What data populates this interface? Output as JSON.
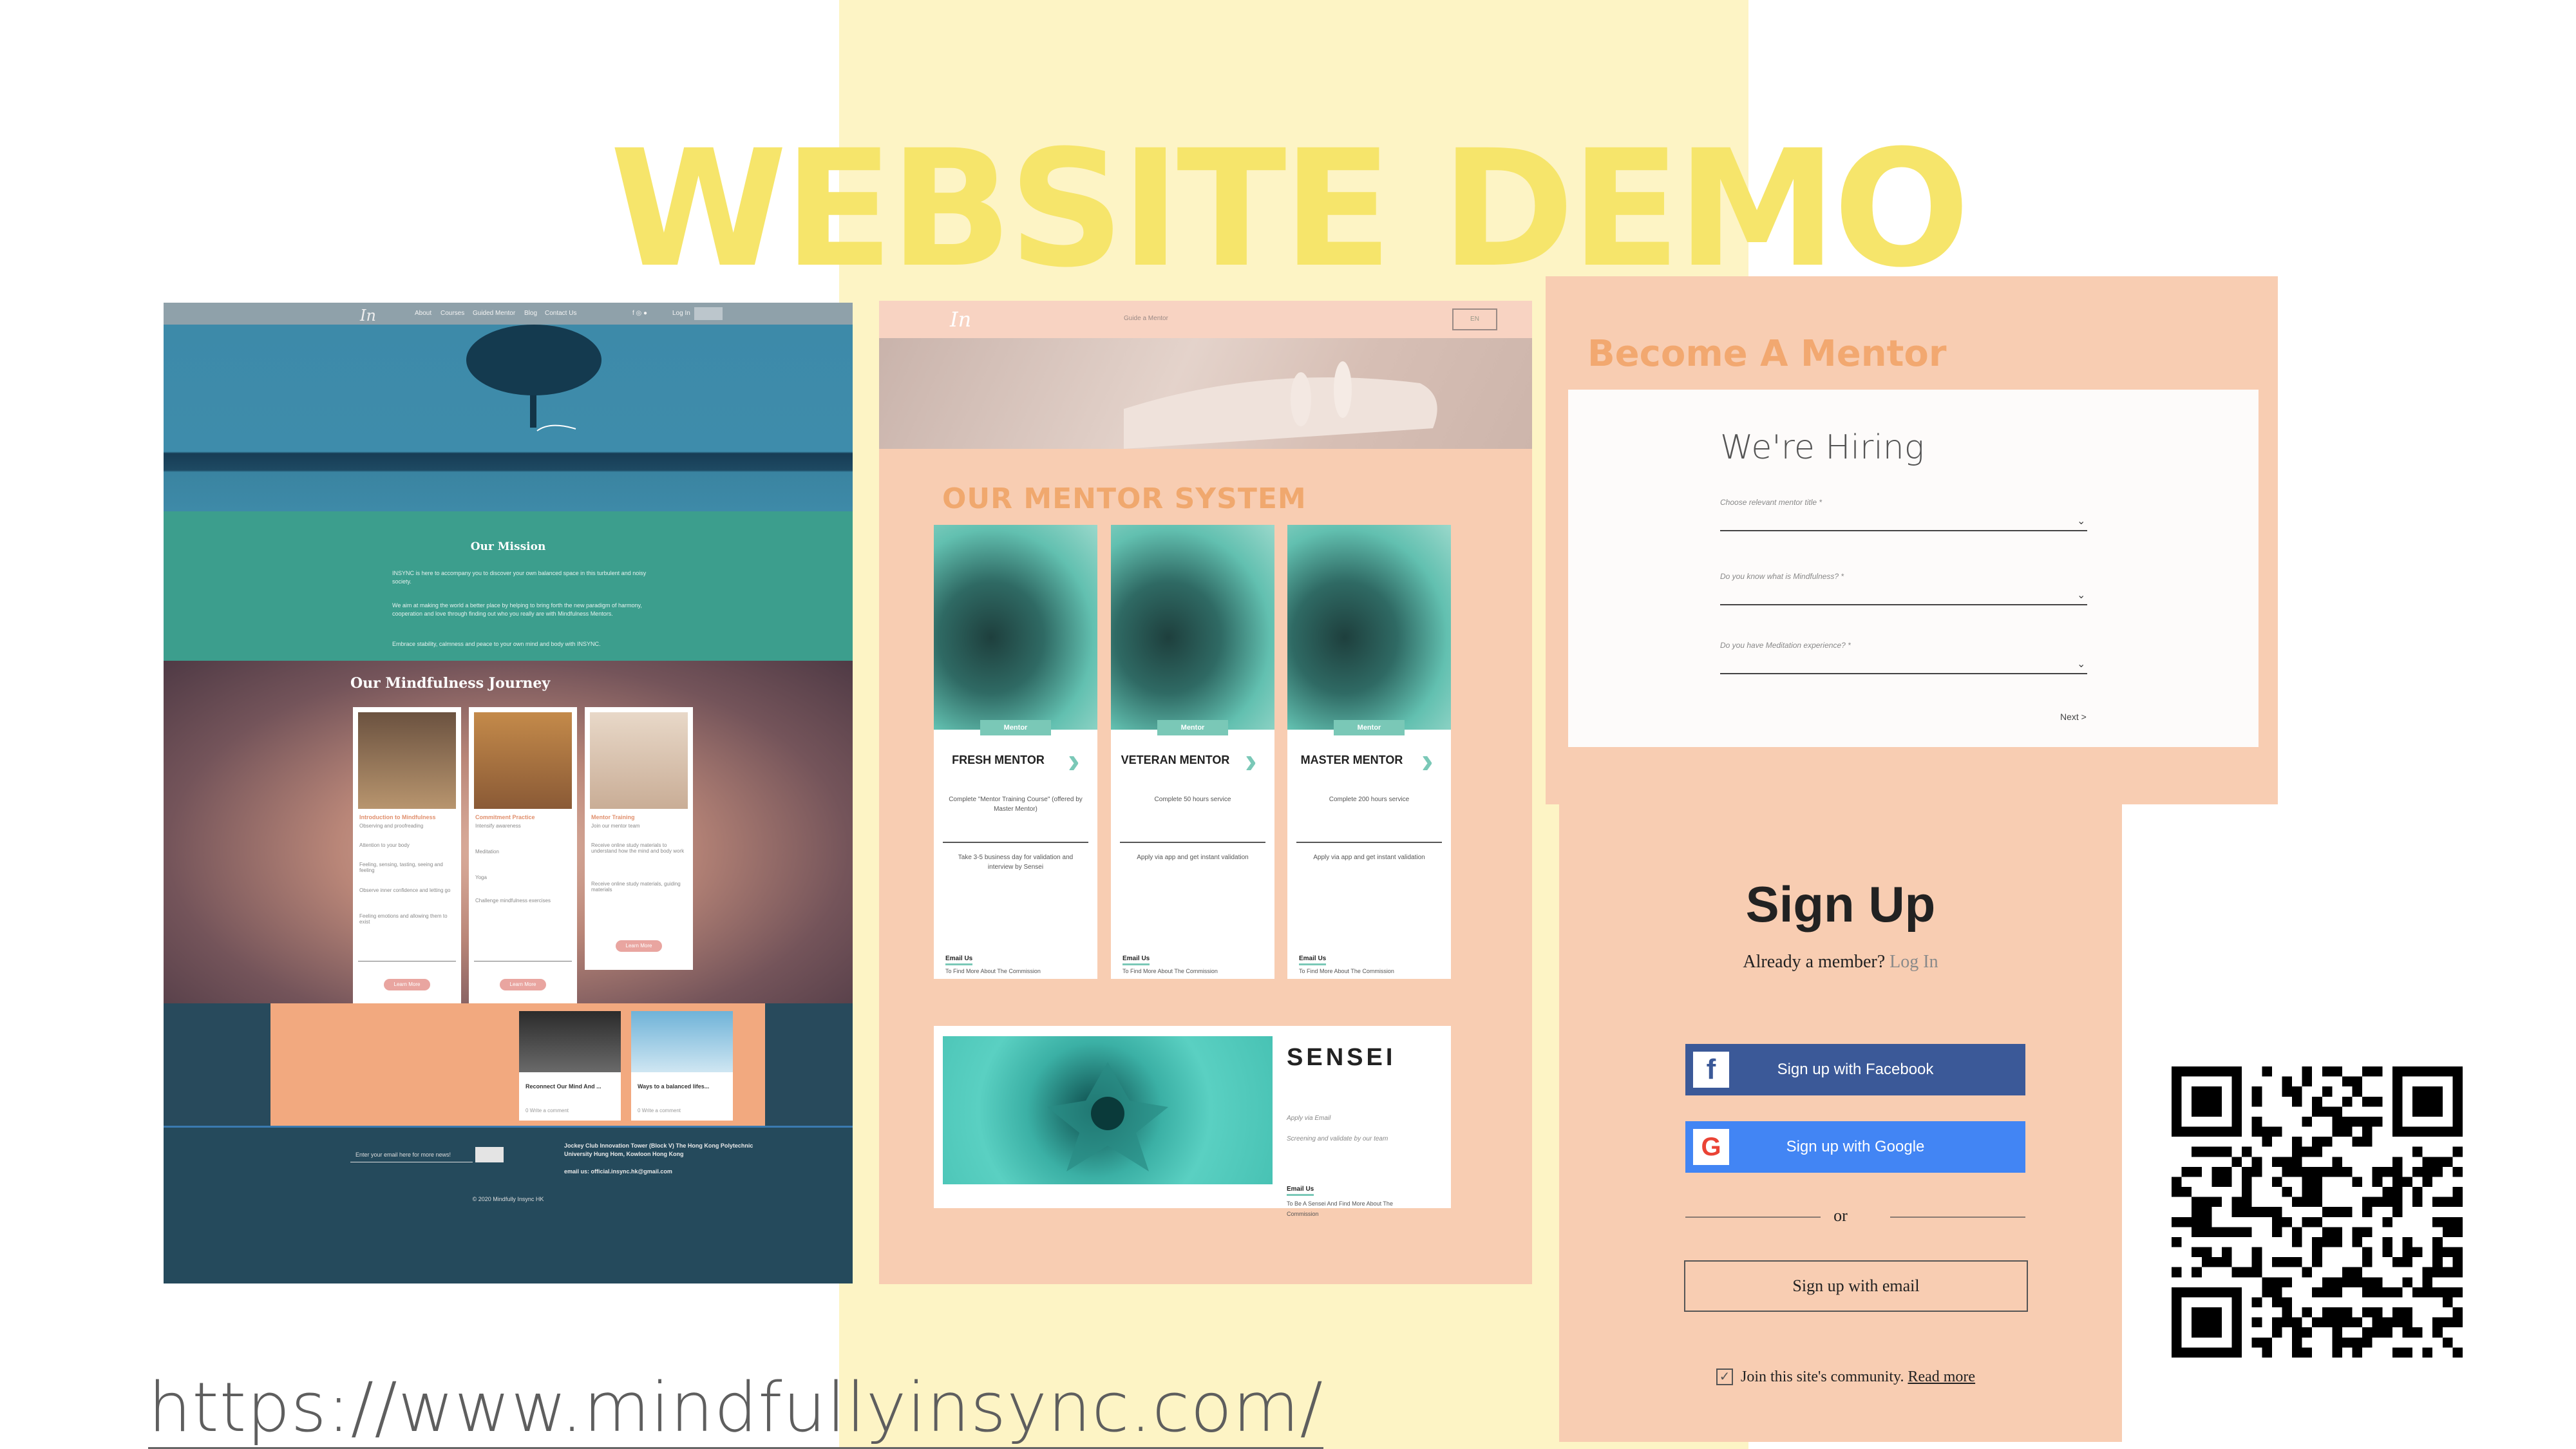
{
  "slide": {
    "title": "WEBSITE DEMO",
    "url": "https://www.mindfullyinsync.com/",
    "colors": {
      "title_yellow": "#f6e56b",
      "band_yellow": "#fdf4c5",
      "peach": "#f8cdb2",
      "teal": "#7ac8b7"
    }
  },
  "home": {
    "nav": {
      "logo": "In",
      "items": [
        "About",
        "Courses",
        "Guided Mentor",
        "Blog",
        "Contact Us"
      ],
      "login": "Log In"
    },
    "mission": {
      "title": "Our Mission",
      "paragraphs": [
        "INSYNC is here to accompany you to discover your own balanced space in this turbulent and noisy society.",
        "We aim at making the world a better place by helping to bring forth the new paradigm of harmony, cooperation and love through finding out who you really are with Mindfulness Mentors.",
        "Embrace stability, calmness and peace to your own mind and body with INSYNC."
      ]
    },
    "journey": {
      "title": "Our Mindfulness Journey",
      "cards": [
        {
          "title": "Introduction to Mindfulness",
          "lines": [
            "Observing and proofreading",
            "Attention to your body",
            "Feeling, sensing, tasting, seeing and feeling",
            "Observe inner confidence and letting go",
            "Feeling emotions and allowing them to exist"
          ],
          "button": "Learn More"
        },
        {
          "title": "Commitment Practice",
          "lines": [
            "Intensify awareness",
            "Meditation",
            "Yoga",
            "Challenge mindfulness exercises"
          ],
          "button": "Learn More"
        },
        {
          "title": "Mentor Training",
          "lines": [
            "Join our mentor team",
            "Receive online study materials to understand how the mind and body work",
            "Receive online study materials, guiding materials"
          ],
          "button": "Learn More"
        }
      ]
    },
    "blog": [
      {
        "title": "Reconnect Our Mind And ...",
        "meta": "0  Write a comment"
      },
      {
        "title": "Ways to a balanced lifes...",
        "meta": "0  Write a comment"
      }
    ],
    "footer": {
      "email_placeholder": "Enter your email here for more news!",
      "address": "Jockey Club Innovation Tower (Block V) The Hong Kong Polytechnic University Hung Hom, Kowloon Hong Kong",
      "email": "email us: official.insync.hk@gmail.com",
      "copyright": "© 2020 Mindfully Insync HK"
    }
  },
  "mentor_page": {
    "nav": {
      "selected": "Guide a Mentor",
      "lang": "EN"
    },
    "section_title": "OUR MENTOR SYSTEM",
    "mentors": [
      {
        "tag": "Mentor",
        "name": "FRESH MENTOR",
        "desc1": "Complete \"Mentor Training Course\" (offered by Master Mentor)",
        "desc2": "Take 3-5 business day for validation and interview by Sensei",
        "email": "Email Us",
        "find": "To Find More About The Commission"
      },
      {
        "tag": "Mentor",
        "name": "VETERAN MENTOR",
        "desc1": "Complete 50 hours service",
        "desc2": "Apply via app and get instant validation",
        "email": "Email Us",
        "find": "To Find More About The Commission"
      },
      {
        "tag": "Mentor",
        "name": "MASTER MENTOR",
        "desc1": "Complete 200 hours service",
        "desc2": "Apply via app and get instant validation",
        "email": "Email Us",
        "find": "To Find More About The Commission"
      }
    ],
    "sensei": {
      "title": "SENSEI",
      "apply": "Apply via Email",
      "screen": "Screening and validate by our team",
      "email": "Email Us",
      "find": "To Be A Sensei And Find More About The Commission"
    }
  },
  "become_mentor": {
    "title": "Become A Mentor",
    "heading": "We're Hiring",
    "fields": [
      "Choose relevant mentor title *",
      "Do you know what is Mindfulness? *",
      "Do you have Meditation experience? *"
    ],
    "next": "Next >"
  },
  "signup": {
    "heading": "Sign Up",
    "member_text": "Already a member?",
    "login_link": "Log In",
    "facebook": "Sign up with Facebook",
    "google": "Sign up with Google",
    "or": "or",
    "email_button": "Sign up with email",
    "join": "Join this site's community.",
    "read_more": "Read more",
    "colors": {
      "facebook": "#3b5998",
      "google": "#4285f4"
    }
  }
}
